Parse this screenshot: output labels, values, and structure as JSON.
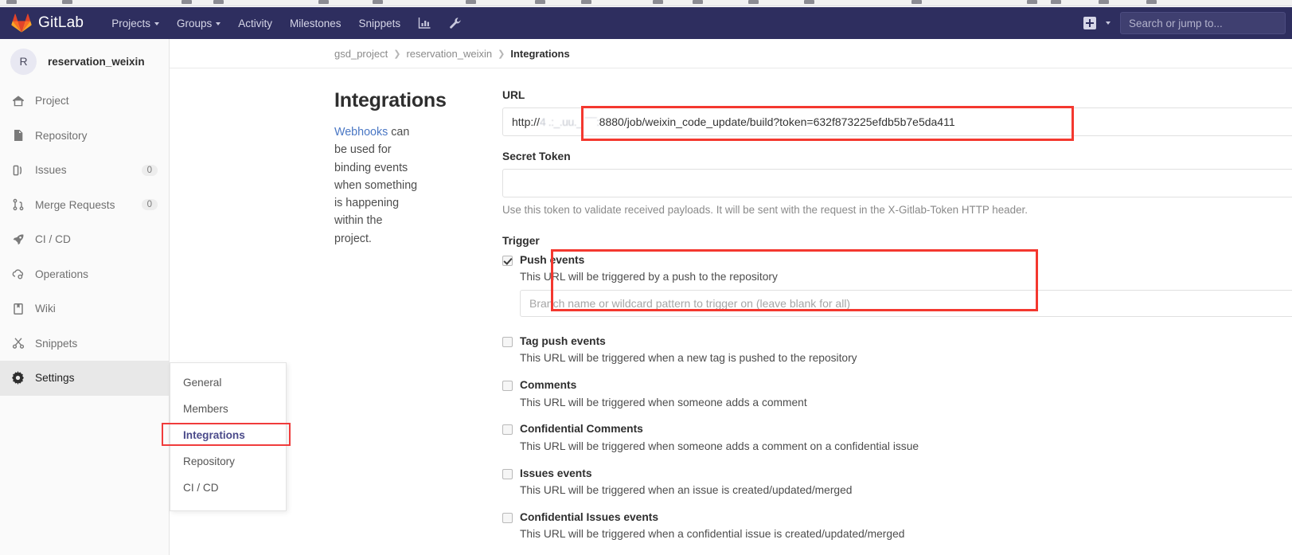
{
  "browser": {
    "tab_stub_count": 14
  },
  "navbar": {
    "brand": "GitLab",
    "brand_icon": "gitlab-tanuki-logo",
    "links": [
      {
        "label": "Projects",
        "has_caret": true
      },
      {
        "label": "Groups",
        "has_caret": true
      },
      {
        "label": "Activity",
        "has_caret": false
      },
      {
        "label": "Milestones",
        "has_caret": false
      },
      {
        "label": "Snippets",
        "has_caret": false
      }
    ],
    "icons": [
      {
        "name": "analytics-chart-icon"
      },
      {
        "name": "wrench-admin-icon"
      }
    ],
    "new_button": {
      "name": "plus-new-icon",
      "has_caret": true
    },
    "search": {
      "placeholder": "Search or jump to...",
      "value": ""
    }
  },
  "sidebar": {
    "project": {
      "avatar_initial": "R",
      "name": "reservation_weixin"
    },
    "items": [
      {
        "label": "Project",
        "icon": "home-icon",
        "count": "",
        "active": false
      },
      {
        "label": "Repository",
        "icon": "document-icon",
        "count": "",
        "active": false
      },
      {
        "label": "Issues",
        "icon": "issues-icon",
        "count": "0",
        "active": false
      },
      {
        "label": "Merge Requests",
        "icon": "merge-icon",
        "count": "0",
        "active": false
      },
      {
        "label": "CI / CD",
        "icon": "rocket-icon",
        "count": "",
        "active": false
      },
      {
        "label": "Operations",
        "icon": "cloud-gear-icon",
        "count": "",
        "active": false
      },
      {
        "label": "Wiki",
        "icon": "book-icon",
        "count": "",
        "active": false
      },
      {
        "label": "Snippets",
        "icon": "scissors-icon",
        "count": "",
        "active": false
      },
      {
        "label": "Settings",
        "icon": "gear-icon",
        "count": "",
        "active": true
      }
    ]
  },
  "settings_flyout": {
    "items": [
      {
        "label": "General",
        "current": false
      },
      {
        "label": "Members",
        "current": false
      },
      {
        "label": "Integrations",
        "current": true
      },
      {
        "label": "Repository",
        "current": false
      },
      {
        "label": "CI / CD",
        "current": false
      }
    ]
  },
  "breadcrumb": [
    {
      "label": "gsd_project",
      "last": false
    },
    {
      "label": "reservation_weixin",
      "last": false
    },
    {
      "label": "Integrations",
      "last": true
    }
  ],
  "page": {
    "title": "Integrations",
    "intro_link": "Webhooks",
    "intro_rest": " can be used for binding events when something is happening within the project."
  },
  "form": {
    "url": {
      "label": "URL",
      "value_prefix": "http://",
      "value_redacted": "4   .:_.uu._ ¯¯:",
      "value_suffix": "8880/job/weixin_code_update/build?token=632f873225efdb5b7e5da411"
    },
    "secret_token": {
      "label": "Secret Token",
      "value": "",
      "placeholder": "",
      "help": "Use this token to validate received payloads. It will be sent with the request in the X-Gitlab-Token HTTP header."
    },
    "trigger_label": "Trigger",
    "triggers": [
      {
        "name": "Push events",
        "description": "This URL will be triggered by a push to the repository",
        "checked": true,
        "branch_input": {
          "placeholder": "Branch name or wildcard pattern to trigger on (leave blank for all)",
          "value": ""
        }
      },
      {
        "name": "Tag push events",
        "description": "This URL will be triggered when a new tag is pushed to the repository",
        "checked": false
      },
      {
        "name": "Comments",
        "description": "This URL will be triggered when someone adds a comment",
        "checked": false
      },
      {
        "name": "Confidential Comments",
        "description": "This URL will be triggered when someone adds a comment on a confidential issue",
        "checked": false
      },
      {
        "name": "Issues events",
        "description": "This URL will be triggered when an issue is created/updated/merged",
        "checked": false
      },
      {
        "name": "Confidential Issues events",
        "description": "This URL will be triggered when a confidential issue is created/updated/merged",
        "checked": false
      }
    ]
  },
  "annotations": {
    "highlight_color": "#f4382f",
    "boxes": [
      {
        "name": "url-field-highlight"
      },
      {
        "name": "push-events-highlight"
      },
      {
        "name": "integrations-menu-highlight"
      }
    ]
  },
  "colors": {
    "navbar_bg": "#2e2e5f",
    "sidebar_bg": "#fafafa",
    "link_blue": "#4a77c4",
    "accent_red": "#f4382f"
  }
}
